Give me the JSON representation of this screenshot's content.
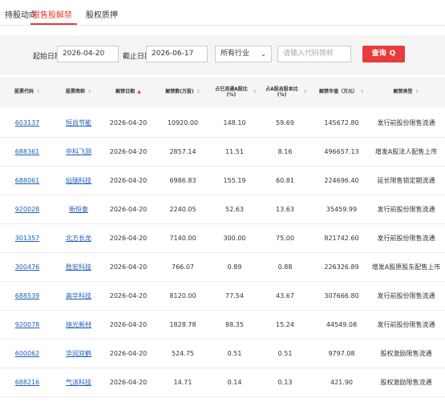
{
  "tabs": [
    {
      "label": "持股动向",
      "active": false
    },
    {
      "label": "限售股解禁",
      "active": true
    },
    {
      "label": "股权质押",
      "active": false
    }
  ],
  "filter": {
    "start_label": "起始日期：",
    "start_value": "2026-04-20",
    "end_label": "截止日期：",
    "end_value": "2026-06-17",
    "industry_value": "所有行业",
    "search_placeholder": "请输入代码简称",
    "query_label": "查询"
  },
  "columns": [
    {
      "label": "股票代码",
      "sort": "none"
    },
    {
      "label": "股票简称",
      "sort": "none"
    },
    {
      "label": "解禁日期",
      "sort": "asc-active"
    },
    {
      "label": "解禁数(万股)",
      "sort": "none"
    },
    {
      "label": "占已流通A股比(%)",
      "sort": "none"
    },
    {
      "label": "占A股总股本比(%)",
      "sort": "none"
    },
    {
      "label": "解禁市值（万元）",
      "sort": "none"
    },
    {
      "label": "解禁类型",
      "sort": "none"
    }
  ],
  "rows": [
    {
      "code": "603137",
      "name": "恒尚节能",
      "date": "2026-04-20",
      "qty": "10920.00",
      "pct_float": "148.10",
      "pct_total": "59.69",
      "value": "145672.80",
      "type": "发行前股份限售流通"
    },
    {
      "code": "688361",
      "name": "中科飞测",
      "date": "2026-04-20",
      "qty": "2857.14",
      "pct_float": "11.51",
      "pct_total": "8.16",
      "value": "496657.13",
      "type": "增发A股法人配售上市"
    },
    {
      "code": "688061",
      "name": "灿瑞科技",
      "date": "2026-04-20",
      "qty": "6986.83",
      "pct_float": "155.19",
      "pct_total": "60.81",
      "value": "224696.40",
      "type": "延长限售锁定期流通"
    },
    {
      "code": "920028",
      "name": "新恒泰",
      "date": "2026-04-20",
      "qty": "2240.05",
      "pct_float": "52.63",
      "pct_total": "13.63",
      "value": "35459.99",
      "type": "发行前股份限售流通"
    },
    {
      "code": "301357",
      "name": "北方长龙",
      "date": "2026-04-20",
      "qty": "7140.00",
      "pct_float": "300.00",
      "pct_total": "75.00",
      "value": "821742.60",
      "type": "发行前股份限售流通"
    },
    {
      "code": "300476",
      "name": "胜宏科技",
      "date": "2026-04-20",
      "qty": "766.07",
      "pct_float": "0.89",
      "pct_total": "0.88",
      "value": "226326.89",
      "type": "增发A股原股东配售上市"
    },
    {
      "code": "688539",
      "name": "高华科技",
      "date": "2026-04-20",
      "qty": "8120.00",
      "pct_float": "77.54",
      "pct_total": "43.67",
      "value": "307666.80",
      "type": "发行前股份限售流通"
    },
    {
      "code": "920078",
      "name": "旭光新材",
      "date": "2026-04-20",
      "qty": "1828.78",
      "pct_float": "88.35",
      "pct_total": "15.24",
      "value": "44549.08",
      "type": "发行前股份限售流通"
    },
    {
      "code": "600062",
      "name": "华润双鹤",
      "date": "2026-04-20",
      "qty": "524.75",
      "pct_float": "0.51",
      "pct_total": "0.51",
      "value": "9797.08",
      "type": "股权激励限售流通"
    },
    {
      "code": "688216",
      "name": "气派科技",
      "date": "2026-04-20",
      "qty": "14.71",
      "pct_float": "0.14",
      "pct_total": "0.13",
      "value": "421.90",
      "type": "股权激励限售流通"
    }
  ],
  "colors": {
    "accent": "#e83c3c",
    "link": "#1e5eb8",
    "panel_bg": "#f5f5f5"
  },
  "icons": {
    "sort": "sort-arrows-icon",
    "search": "search-icon",
    "dropdown": "chevron-down-icon"
  }
}
